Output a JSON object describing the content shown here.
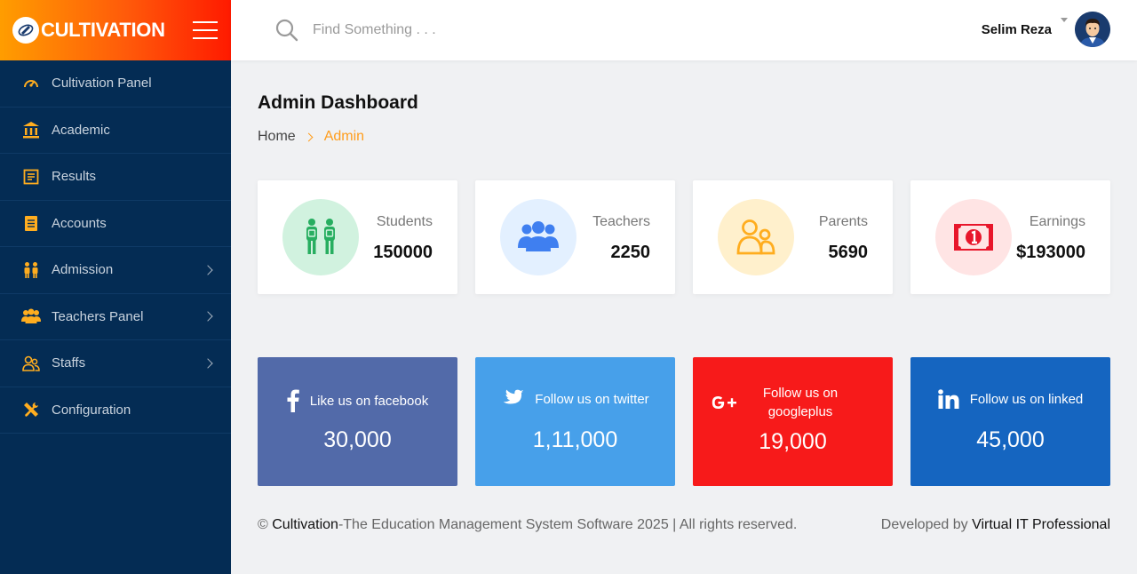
{
  "brand": {
    "name": "CULTIVATION"
  },
  "header": {
    "search_placeholder": "Find Something . . .",
    "user_name": "Selim Reza"
  },
  "sidebar": {
    "items": [
      {
        "label": "Cultivation Panel",
        "icon": "speedometer-icon",
        "has_submenu": false
      },
      {
        "label": "Academic",
        "icon": "bank-icon",
        "has_submenu": false
      },
      {
        "label": "Results",
        "icon": "document-icon",
        "has_submenu": false
      },
      {
        "label": "Accounts",
        "icon": "notepad-icon",
        "has_submenu": false
      },
      {
        "label": "Admission",
        "icon": "students-icon",
        "has_submenu": true
      },
      {
        "label": "Teachers Panel",
        "icon": "group-icon",
        "has_submenu": true
      },
      {
        "label": "Staffs",
        "icon": "staff-icon",
        "has_submenu": true
      },
      {
        "label": "Configuration",
        "icon": "tools-icon",
        "has_submenu": false
      }
    ]
  },
  "main": {
    "title": "Admin Dashboard",
    "breadcrumb": {
      "home": "Home",
      "current": "Admin"
    },
    "stats": [
      {
        "label": "Students",
        "value": "150000",
        "icon": "students-icon",
        "bg": "#d1f2df",
        "fg": "#27ae60"
      },
      {
        "label": "Teachers",
        "value": "2250",
        "icon": "group-icon",
        "bg": "#e3f0ff",
        "fg": "#3f7ff0"
      },
      {
        "label": "Parents",
        "value": "5690",
        "icon": "parents-icon",
        "bg": "#fff0cc",
        "fg": "#ffad1f"
      },
      {
        "label": "Earnings",
        "value": "$193000",
        "icon": "money-icon",
        "bg": "#ffe4e4",
        "fg": "#e8162b"
      }
    ],
    "social": [
      {
        "label": "Like us on facebook",
        "count": "30,000",
        "icon": "facebook-icon",
        "color": "#526aa9"
      },
      {
        "label": "Follow us on twitter",
        "count": "1,11,000",
        "icon": "twitter-icon",
        "color": "#47a0ea"
      },
      {
        "label_line1": "Follow us on",
        "label_line2": "googleplus",
        "count": "19,000",
        "icon": "google-plus-icon",
        "color": "#f71a1a"
      },
      {
        "label": "Follow us on linked",
        "count": "45,000",
        "icon": "linkedin-icon",
        "color": "#1565c0"
      }
    ]
  },
  "footer": {
    "copyright_symbol": "©",
    "brand": "Cultivation",
    "text": "-The Education Management System Software 2025 | All rights reserved.",
    "developed_by": "Developed by",
    "developer": "Virtual IT Professional"
  }
}
